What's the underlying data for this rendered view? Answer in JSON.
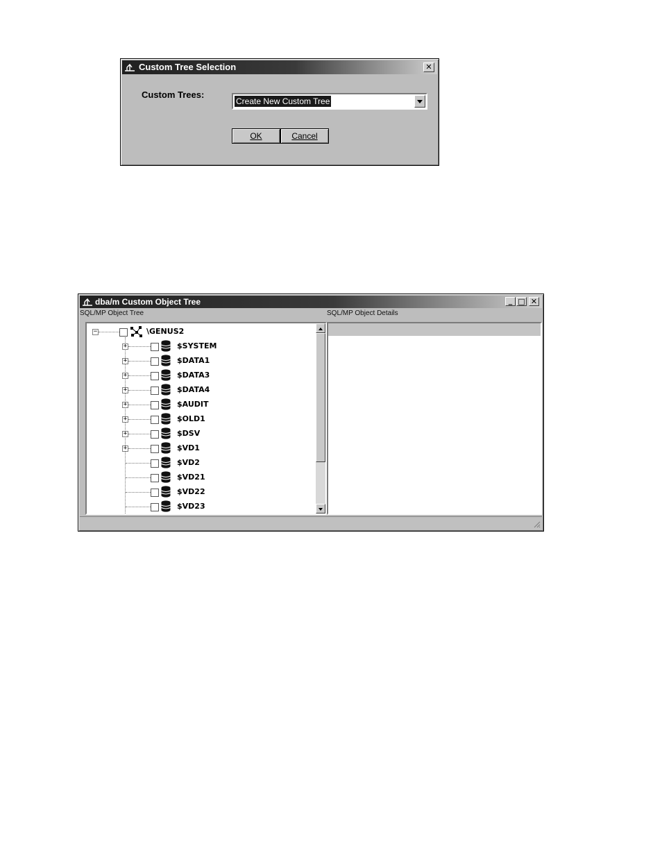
{
  "dialog": {
    "title": "Custom Tree Selection",
    "close_glyph": "✕",
    "custom_trees_label": "Custom Trees:",
    "combo_value": "Create New Custom Tree",
    "ok_label": "OK",
    "cancel_label": "Cancel"
  },
  "treewin": {
    "title": "dba/m Custom Object Tree",
    "minimize_glyph": "_",
    "maximize_glyph": "□",
    "close_glyph": "✕",
    "left_pane_label": "SQL/MP Object Tree",
    "right_pane_label": "SQL/MP Object Details",
    "root": {
      "label": "\\GENUS2",
      "expander": "−"
    },
    "items": [
      {
        "label": "$SYSTEM",
        "expander": "+"
      },
      {
        "label": "$DATA1",
        "expander": "+"
      },
      {
        "label": "$DATA3",
        "expander": "+"
      },
      {
        "label": "$DATA4",
        "expander": "+"
      },
      {
        "label": "$AUDIT",
        "expander": "+"
      },
      {
        "label": "$OLD1",
        "expander": "+"
      },
      {
        "label": "$DSV",
        "expander": "+"
      },
      {
        "label": "$VD1",
        "expander": "+"
      },
      {
        "label": "$VD2",
        "expander": ""
      },
      {
        "label": "$VD21",
        "expander": ""
      },
      {
        "label": "$VD22",
        "expander": ""
      },
      {
        "label": "$VD23",
        "expander": ""
      }
    ]
  }
}
